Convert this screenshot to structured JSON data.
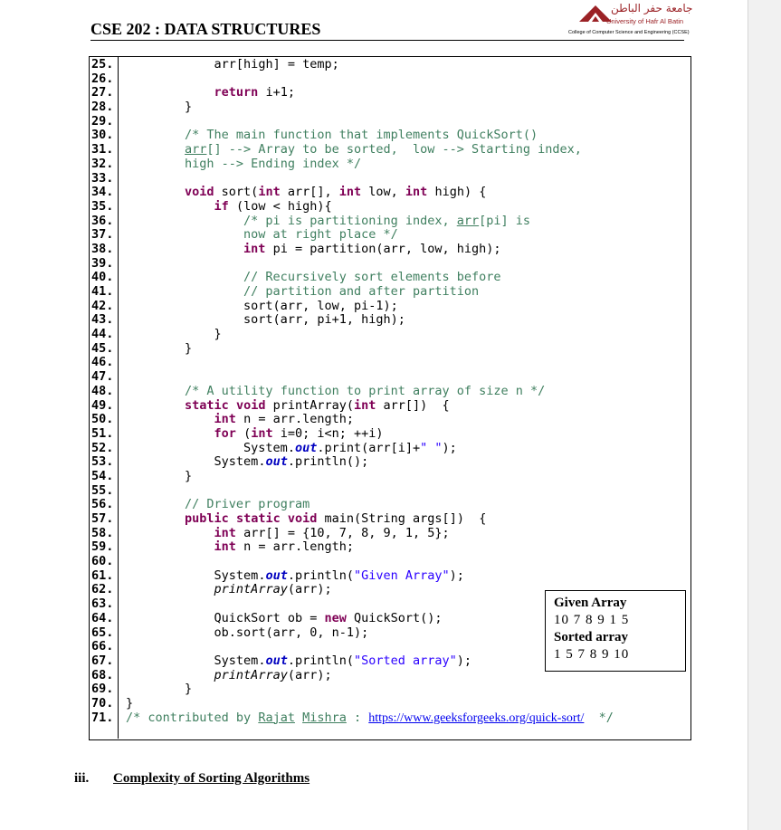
{
  "header": {
    "course_title": "CSE 202 : DATA STRUCTURES",
    "logo": {
      "arabic_name": "جامعة حفر الباطن",
      "english_name": "University of Hafr Al Batin",
      "college": "College of Computer Science and Engineering (CCSE)"
    }
  },
  "code_lines": [
    {
      "n": "25.",
      "indent": 12,
      "parts": [
        {
          "t": "arr[high] = temp;"
        }
      ]
    },
    {
      "n": "26.",
      "indent": 0,
      "parts": []
    },
    {
      "n": "27.",
      "indent": 12,
      "parts": [
        {
          "t": "return",
          "c": "kw"
        },
        {
          "t": " i+1;"
        }
      ]
    },
    {
      "n": "28.",
      "indent": 8,
      "parts": [
        {
          "t": "}"
        }
      ]
    },
    {
      "n": "29.",
      "indent": 0,
      "parts": []
    },
    {
      "n": "30.",
      "indent": 8,
      "parts": [
        {
          "t": "/* The main function that implements QuickSort()",
          "c": "cm"
        }
      ]
    },
    {
      "n": "31.",
      "indent": 8,
      "parts": [
        {
          "t": "arr",
          "c": "cm ul"
        },
        {
          "t": "[] --> Array to be sorted,  low --> Starting index,",
          "c": "cm"
        }
      ]
    },
    {
      "n": "32.",
      "indent": 8,
      "parts": [
        {
          "t": "high --> Ending index */",
          "c": "cm"
        }
      ]
    },
    {
      "n": "33.",
      "indent": 0,
      "parts": []
    },
    {
      "n": "34.",
      "indent": 8,
      "parts": [
        {
          "t": "void",
          "c": "kw"
        },
        {
          "t": " sort("
        },
        {
          "t": "int",
          "c": "kw"
        },
        {
          "t": " arr[], "
        },
        {
          "t": "int",
          "c": "kw"
        },
        {
          "t": " low, "
        },
        {
          "t": "int",
          "c": "kw"
        },
        {
          "t": " high) {"
        }
      ]
    },
    {
      "n": "35.",
      "indent": 12,
      "parts": [
        {
          "t": "if",
          "c": "kw"
        },
        {
          "t": " (low < high){"
        }
      ]
    },
    {
      "n": "36.",
      "indent": 16,
      "parts": [
        {
          "t": "/* pi is partitioning index, ",
          "c": "cm"
        },
        {
          "t": "arr",
          "c": "cm ul"
        },
        {
          "t": "[pi] is",
          "c": "cm"
        }
      ]
    },
    {
      "n": "37.",
      "indent": 16,
      "parts": [
        {
          "t": "now at right place */",
          "c": "cm"
        }
      ]
    },
    {
      "n": "38.",
      "indent": 16,
      "parts": [
        {
          "t": "int",
          "c": "kw"
        },
        {
          "t": " pi = partition(arr, low, high);"
        }
      ]
    },
    {
      "n": "39.",
      "indent": 0,
      "parts": []
    },
    {
      "n": "40.",
      "indent": 16,
      "parts": [
        {
          "t": "// Recursively sort elements before",
          "c": "cm"
        }
      ]
    },
    {
      "n": "41.",
      "indent": 16,
      "parts": [
        {
          "t": "// partition and after partition",
          "c": "cm"
        }
      ]
    },
    {
      "n": "42.",
      "indent": 16,
      "parts": [
        {
          "t": "sort(arr, low, pi-1);"
        }
      ]
    },
    {
      "n": "43.",
      "indent": 16,
      "parts": [
        {
          "t": "sort(arr, pi+1, high);"
        }
      ]
    },
    {
      "n": "44.",
      "indent": 12,
      "parts": [
        {
          "t": "}"
        }
      ]
    },
    {
      "n": "45.",
      "indent": 8,
      "parts": [
        {
          "t": "}"
        }
      ]
    },
    {
      "n": "46.",
      "indent": 0,
      "parts": []
    },
    {
      "n": "47.",
      "indent": 0,
      "parts": []
    },
    {
      "n": "48.",
      "indent": 8,
      "parts": [
        {
          "t": "/* A utility function to print array of size n */",
          "c": "cm"
        }
      ]
    },
    {
      "n": "49.",
      "indent": 8,
      "parts": [
        {
          "t": "static",
          "c": "kw"
        },
        {
          "t": " "
        },
        {
          "t": "void",
          "c": "kw"
        },
        {
          "t": " printArray("
        },
        {
          "t": "int",
          "c": "kw"
        },
        {
          "t": " arr[])  {"
        }
      ]
    },
    {
      "n": "50.",
      "indent": 12,
      "parts": [
        {
          "t": "int",
          "c": "kw"
        },
        {
          "t": " n = arr.length;"
        }
      ]
    },
    {
      "n": "51.",
      "indent": 12,
      "parts": [
        {
          "t": "for",
          "c": "kw"
        },
        {
          "t": " ("
        },
        {
          "t": "int",
          "c": "kw"
        },
        {
          "t": " i=0; i<n; ++i)"
        }
      ]
    },
    {
      "n": "52.",
      "indent": 16,
      "parts": [
        {
          "t": "System."
        },
        {
          "t": "out",
          "c": "fld"
        },
        {
          "t": ".print(arr[i]+"
        },
        {
          "t": "\" \"",
          "c": "str"
        },
        {
          "t": ");"
        }
      ]
    },
    {
      "n": "53.",
      "indent": 12,
      "parts": [
        {
          "t": "System."
        },
        {
          "t": "out",
          "c": "fld"
        },
        {
          "t": ".println();"
        }
      ]
    },
    {
      "n": "54.",
      "indent": 8,
      "parts": [
        {
          "t": "}"
        }
      ]
    },
    {
      "n": "55.",
      "indent": 0,
      "parts": []
    },
    {
      "n": "56.",
      "indent": 8,
      "parts": [
        {
          "t": "// Driver program",
          "c": "cm"
        }
      ]
    },
    {
      "n": "57.",
      "indent": 8,
      "parts": [
        {
          "t": "public",
          "c": "kw"
        },
        {
          "t": " "
        },
        {
          "t": "static",
          "c": "kw"
        },
        {
          "t": " "
        },
        {
          "t": "void",
          "c": "kw"
        },
        {
          "t": " main(String args[])  {"
        }
      ]
    },
    {
      "n": "58.",
      "indent": 12,
      "parts": [
        {
          "t": "int",
          "c": "kw"
        },
        {
          "t": " arr[] = {10, 7, 8, 9, 1, 5};"
        }
      ]
    },
    {
      "n": "59.",
      "indent": 12,
      "parts": [
        {
          "t": "int",
          "c": "kw"
        },
        {
          "t": " n = arr.length;"
        }
      ]
    },
    {
      "n": "60.",
      "indent": 0,
      "parts": []
    },
    {
      "n": "61.",
      "indent": 12,
      "parts": [
        {
          "t": "System."
        },
        {
          "t": "out",
          "c": "fld"
        },
        {
          "t": ".println("
        },
        {
          "t": "\"Given Array\"",
          "c": "str"
        },
        {
          "t": ");"
        }
      ]
    },
    {
      "n": "62.",
      "indent": 12,
      "parts": [
        {
          "t": "printArray",
          "c": "it"
        },
        {
          "t": "(arr);"
        }
      ]
    },
    {
      "n": "63.",
      "indent": 0,
      "parts": []
    },
    {
      "n": "64.",
      "indent": 12,
      "parts": [
        {
          "t": "QuickSort ob = "
        },
        {
          "t": "new",
          "c": "kw"
        },
        {
          "t": " QuickSort();"
        }
      ]
    },
    {
      "n": "65.",
      "indent": 12,
      "parts": [
        {
          "t": "ob.sort(arr, 0, n-1);"
        }
      ]
    },
    {
      "n": "66.",
      "indent": 0,
      "parts": []
    },
    {
      "n": "67.",
      "indent": 12,
      "parts": [
        {
          "t": "System."
        },
        {
          "t": "out",
          "c": "fld"
        },
        {
          "t": ".println("
        },
        {
          "t": "\"Sorted array\"",
          "c": "str"
        },
        {
          "t": ");"
        }
      ]
    },
    {
      "n": "68.",
      "indent": 12,
      "parts": [
        {
          "t": "printArray",
          "c": "it"
        },
        {
          "t": "(arr);"
        }
      ]
    },
    {
      "n": "69.",
      "indent": 8,
      "parts": [
        {
          "t": "}"
        }
      ]
    },
    {
      "n": "70.",
      "indent": 0,
      "parts": [
        {
          "t": "}"
        }
      ]
    },
    {
      "n": "71.",
      "indent": 0,
      "parts": [
        {
          "t": "/* contributed by ",
          "c": "cm"
        },
        {
          "t": "Rajat",
          "c": "cm ul"
        },
        {
          "t": " ",
          "c": "cm"
        },
        {
          "t": "Mishra",
          "c": "cm ul"
        },
        {
          "t": " : ",
          "c": "cm"
        },
        {
          "t": "https://www.geeksforgeeks.org/quick-sort/",
          "c": "lnk"
        },
        {
          "t": "  */",
          "c": "cm"
        }
      ]
    }
  ],
  "output": {
    "given_label": "Given Array",
    "given_values": "10 7 8 9 1 5",
    "sorted_label": "Sorted array",
    "sorted_values": "1 5 7 8 9 10"
  },
  "section": {
    "number": "iii.",
    "title": "Complexity of Sorting Algorithms"
  },
  "colors": {
    "keyword": "#7f0055",
    "comment": "#3f7f5f",
    "string": "#2a00ff",
    "field": "#0000c0",
    "logo": "#9b2226"
  }
}
